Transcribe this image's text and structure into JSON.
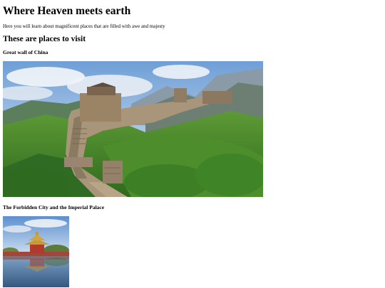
{
  "page": {
    "title": "Where Heaven meets earth",
    "intro": "Here you will learn about magnificent places that are filled with awe and majesty",
    "section_heading": "These are places to visit"
  },
  "places": [
    {
      "name": "Great wall of China",
      "image": "great-wall-photo"
    },
    {
      "name": "The Forbidden City and the Imperial Palace",
      "image": "forbidden-city-photo"
    }
  ]
}
